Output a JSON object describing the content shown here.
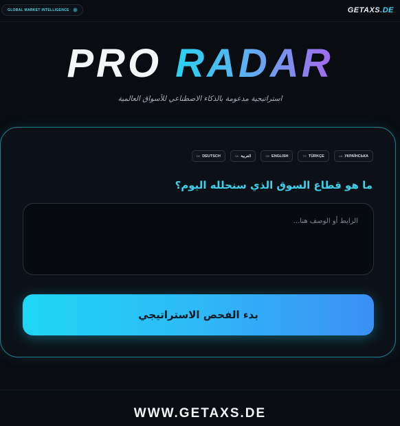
{
  "header": {
    "badge_label": "GLOBAL MARKET INTELLIGENCE",
    "brand_main": "GETAXS",
    "brand_tld": ".DE"
  },
  "hero": {
    "title_word1": "PRO",
    "title_word2": "RADAR",
    "tagline": "استراتيجية مدعومة بالذكاء الاصطناعي للأسواق العالمية"
  },
  "languages": [
    {
      "code": "DE",
      "label": "DEUTSCH"
    },
    {
      "code": "SA",
      "label": "العربية"
    },
    {
      "code": "GB",
      "label": "ENGLISH"
    },
    {
      "code": "TR",
      "label": "TÜRKÇE"
    },
    {
      "code": "UA",
      "label": "УКРАЇНСЬКА"
    }
  ],
  "form": {
    "question": "ما هو قطاع السوق الذي سنحلله اليوم؟",
    "input_value": "",
    "input_placeholder": "الرابط أو الوصف هنا...",
    "submit_label": "بدء الفحص الاستراتيجي"
  },
  "footer": {
    "brand": "WWW.GETAXS.DE"
  },
  "colors": {
    "accent_cyan": "#3fd0ea",
    "accent_purple": "#a469ec",
    "background": "#090c11"
  }
}
